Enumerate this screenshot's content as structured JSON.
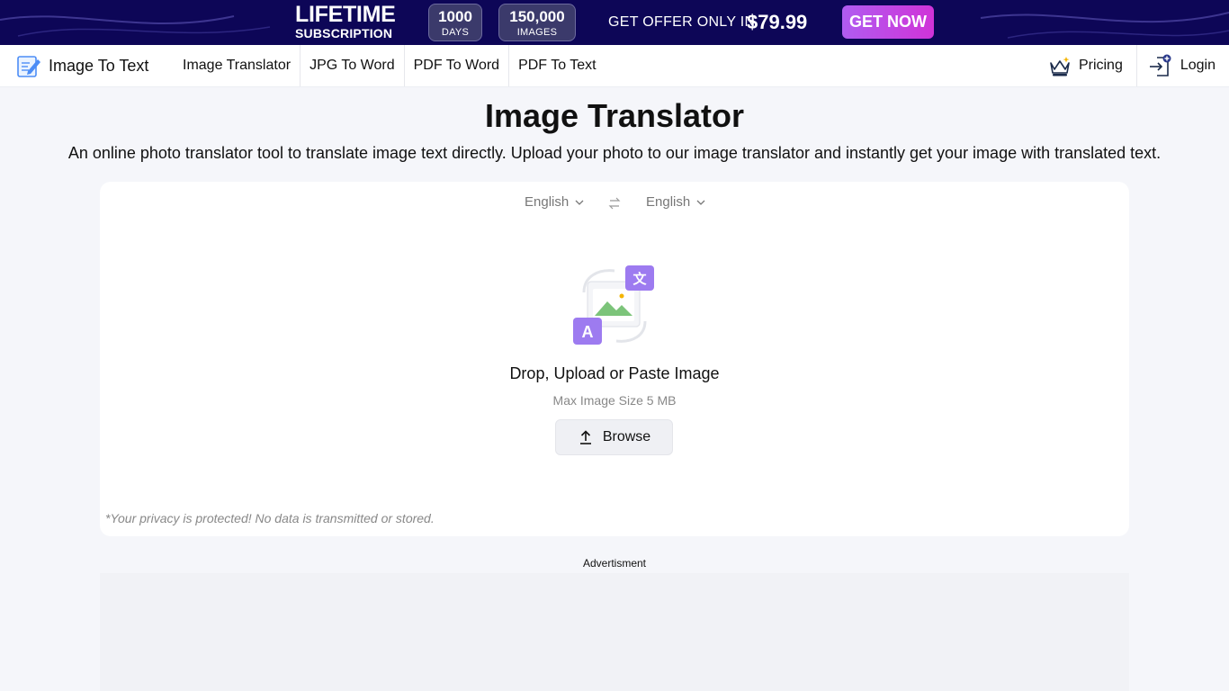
{
  "promo": {
    "lifetime": "LIFETIME",
    "subscription": "SUBSCRIPTION",
    "days_value": "1000",
    "days_unit": "DAYS",
    "images_value": "150,000",
    "images_unit": "IMAGES",
    "offer_text": "GET OFFER ONLY IN",
    "price": "$79.99",
    "cta": "GET NOW",
    "colors": {
      "background": "#0d0657",
      "cta_gradient_start": "#b05cf0",
      "cta_gradient_end": "#d033d8"
    }
  },
  "nav": {
    "logo_icon": "notepad-pencil-icon",
    "logo_text": "Image To Text",
    "links": [
      {
        "label": "Image Translator"
      },
      {
        "label": "JPG To Word"
      },
      {
        "label": "PDF To Word"
      },
      {
        "label": "PDF To Text"
      }
    ],
    "pricing": {
      "icon": "crown-icon",
      "label": "Pricing"
    },
    "login": {
      "icon": "login-icon",
      "label": "Login"
    }
  },
  "main": {
    "title": "Image Translator",
    "description": "An online photo translator tool to translate image text directly. Upload your photo to our image translator and instantly get your image with translated text."
  },
  "tool": {
    "source_language": "English",
    "target_language": "English",
    "swap_icon": "swap-arrows-icon",
    "illustration": "image-translate-illustration",
    "drop_title": "Drop, Upload or Paste Image",
    "max_size": "Max Image Size 5 MB",
    "browse_icon": "upload-arrow-icon",
    "browse_label": "Browse",
    "privacy": "*Your privacy is protected! No data is transmitted or stored.",
    "accent_color": "#9d7bf0"
  },
  "advert": {
    "label": "Advertisment"
  }
}
